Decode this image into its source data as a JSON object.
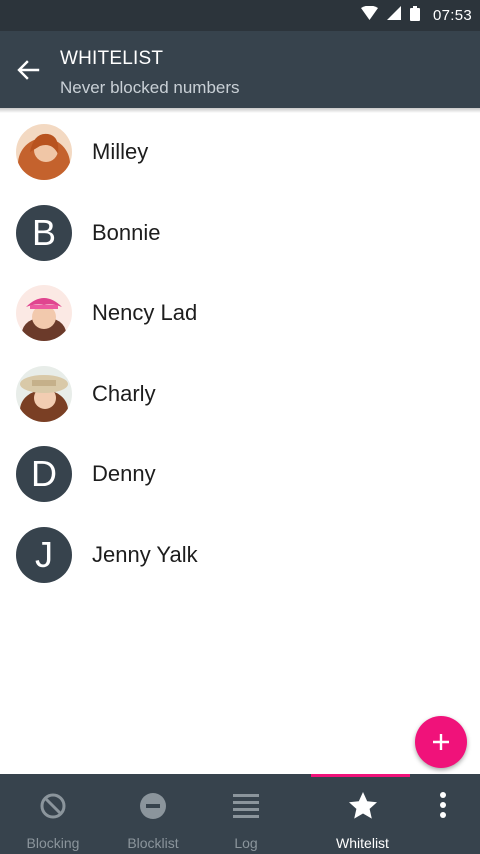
{
  "status_bar": {
    "time": "07:53",
    "icons": [
      "wifi-icon",
      "signal-icon",
      "battery-icon"
    ]
  },
  "app_bar": {
    "title": "WHITELIST",
    "subtitle": "Never blocked numbers",
    "back_icon": "arrow-back-icon"
  },
  "contacts": [
    {
      "name": "Milley",
      "avatar": "photo"
    },
    {
      "name": "Bonnie",
      "avatar": "letter",
      "initial": "B"
    },
    {
      "name": "Nency Lad",
      "avatar": "photo"
    },
    {
      "name": "Charly",
      "avatar": "photo"
    },
    {
      "name": "Denny",
      "avatar": "letter",
      "initial": "D"
    },
    {
      "name": "Jenny Yalk",
      "avatar": "letter",
      "initial": "J"
    }
  ],
  "fab": {
    "icon": "plus-icon"
  },
  "bottom_nav": {
    "items": [
      {
        "label": "Blocking",
        "icon": "block-icon"
      },
      {
        "label": "Blocklist",
        "icon": "minus-circle-icon"
      },
      {
        "label": "Log",
        "icon": "list-icon"
      },
      {
        "label": "Whitelist",
        "icon": "star-icon",
        "active": true
      }
    ],
    "overflow_icon": "more-vert-icon"
  },
  "colors": {
    "status_bar": "#2c343b",
    "app_bar": "#37434d",
    "accent": "#f0127a",
    "nav_inactive": "#8b959c",
    "nav_active": "#ffffff"
  }
}
